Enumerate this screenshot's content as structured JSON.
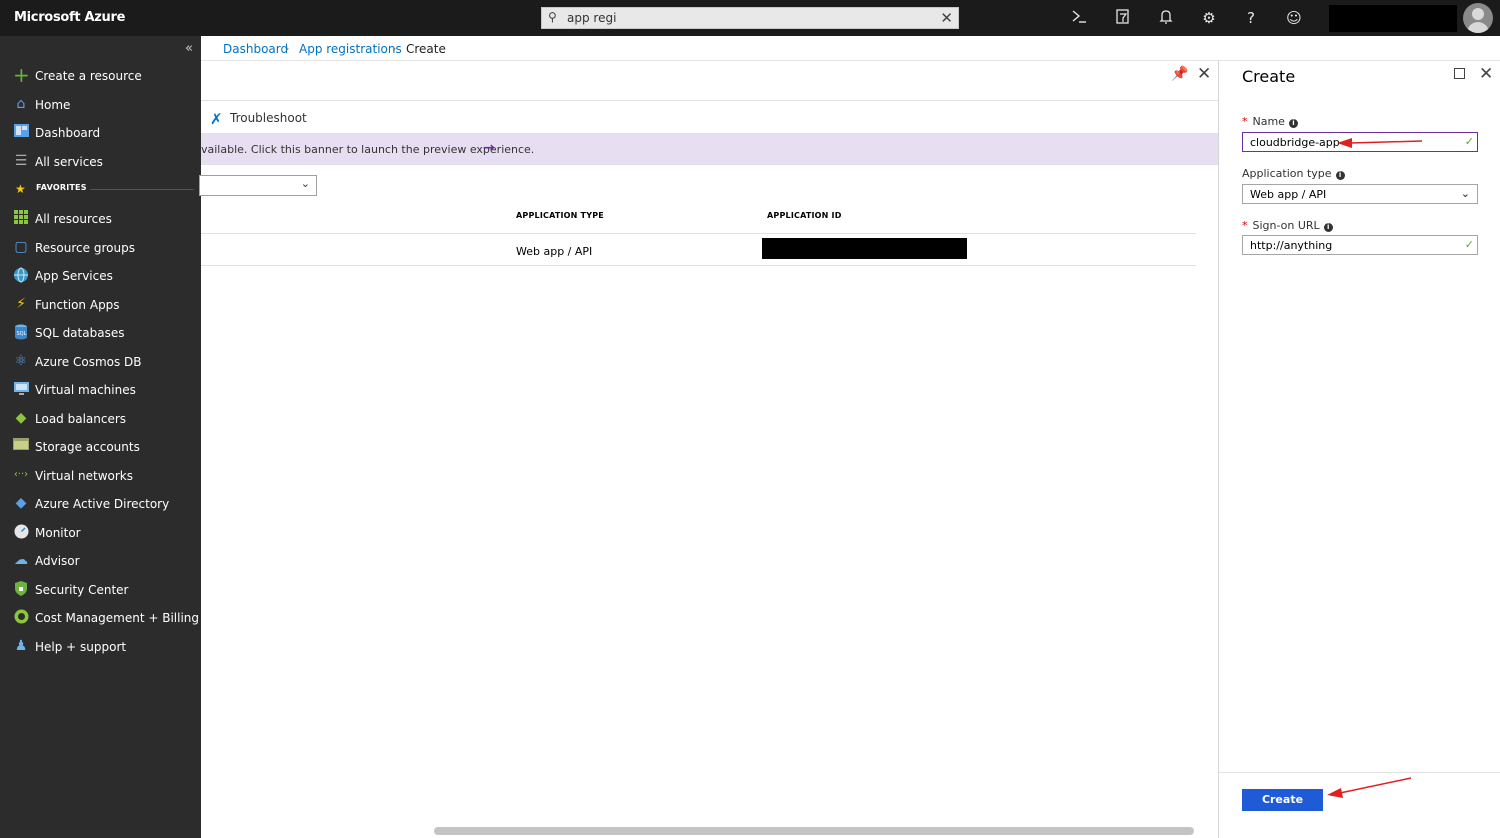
{
  "app": {
    "brand": "Microsoft Azure"
  },
  "search": {
    "value": "app regi"
  },
  "colors": {
    "accent": "#0072c6",
    "primary_button": "#1f5bd6",
    "topbar": "#1b1b1b",
    "sidebar": "#2c2c2c",
    "banner": "#e8def2",
    "annotation_arrow": "#e02020"
  },
  "topbar_icons": [
    "cloud-shell-icon",
    "directory-filter-icon",
    "notifications-icon",
    "settings-icon",
    "help-icon",
    "feedback-icon"
  ],
  "sidebar": {
    "top_items": [
      {
        "label": "Create a resource",
        "icon": "plus-icon"
      },
      {
        "label": "Home",
        "icon": "home-icon"
      },
      {
        "label": "Dashboard",
        "icon": "dashboard-icon"
      },
      {
        "label": "All services",
        "icon": "list-icon"
      }
    ],
    "favorites_label": "FAVORITES",
    "favorites": [
      {
        "label": "All resources",
        "icon": "grid-icon"
      },
      {
        "label": "Resource groups",
        "icon": "cube-icon"
      },
      {
        "label": "App Services",
        "icon": "globe-icon"
      },
      {
        "label": "Function Apps",
        "icon": "lightning-icon"
      },
      {
        "label": "SQL databases",
        "icon": "sql-icon"
      },
      {
        "label": "Azure Cosmos DB",
        "icon": "planet-icon"
      },
      {
        "label": "Virtual machines",
        "icon": "monitor-icon"
      },
      {
        "label": "Load balancers",
        "icon": "diamond-icon"
      },
      {
        "label": "Storage accounts",
        "icon": "storage-icon"
      },
      {
        "label": "Virtual networks",
        "icon": "network-icon"
      },
      {
        "label": "Azure Active Directory",
        "icon": "pyramid-icon"
      },
      {
        "label": "Monitor",
        "icon": "gauge-icon"
      },
      {
        "label": "Advisor",
        "icon": "cloud-icon"
      },
      {
        "label": "Security Center",
        "icon": "shield-icon"
      },
      {
        "label": "Cost Management + Billing",
        "icon": "coin-icon"
      },
      {
        "label": "Help + support",
        "icon": "person-icon"
      }
    ]
  },
  "breadcrumb": {
    "items": [
      "Dashboard",
      "App registrations",
      "Create"
    ]
  },
  "blade": {
    "toolbar": {
      "troubleshoot": "Troubleshoot"
    },
    "banner": {
      "text": "vailable. Click this banner to launch the preview experience."
    },
    "table": {
      "headers": [
        "APPLICATION TYPE",
        "APPLICATION ID"
      ],
      "rows": [
        {
          "type": "Web app / API"
        }
      ]
    }
  },
  "create_panel": {
    "title": "Create",
    "name_label": "Name",
    "name_value": "cloudbridge-app",
    "app_type_label": "Application type",
    "app_type_value": "Web app / API",
    "signon_label": "Sign-on URL",
    "signon_value": "http://anything",
    "create_button": "Create"
  }
}
